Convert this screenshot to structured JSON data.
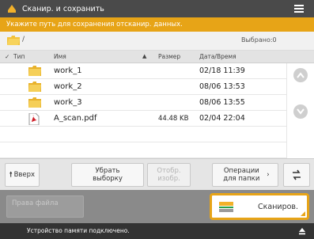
{
  "window": {
    "title": "Сканир. и сохранить"
  },
  "instruction": "Укажите путь для сохранения отсканир. данных.",
  "pathbar": {
    "path": "/",
    "selected_label": "Выбрано:0"
  },
  "columns": {
    "type": "Тип",
    "name": "Имя",
    "size": "Размер",
    "datetime": "Дата/Время"
  },
  "files": [
    {
      "icon": "folder-icon",
      "name": "work_1",
      "size": "",
      "date": "02/18 11:39"
    },
    {
      "icon": "folder-icon",
      "name": "work_2",
      "size": "",
      "date": "08/06 13:53"
    },
    {
      "icon": "folder-icon",
      "name": "work_3",
      "size": "",
      "date": "08/06 13:55"
    },
    {
      "icon": "pdf-file-icon",
      "name": "A_scan.pdf",
      "size": "44.48 KB",
      "date": "02/04 22:04"
    }
  ],
  "toolbar": {
    "up": "Вверх",
    "clear_selection": "Убрать выборку",
    "display_image": "Отобр. изобр.",
    "folder_ops": "Операции для папки"
  },
  "actions": {
    "access_rights": "Права файла",
    "scan": "Сканиров."
  },
  "status": {
    "message": "Устройство памяти подключено."
  },
  "colors": {
    "accent": "#e7a417",
    "titlebar": "#4a4a4a",
    "statusbar": "#333333"
  }
}
